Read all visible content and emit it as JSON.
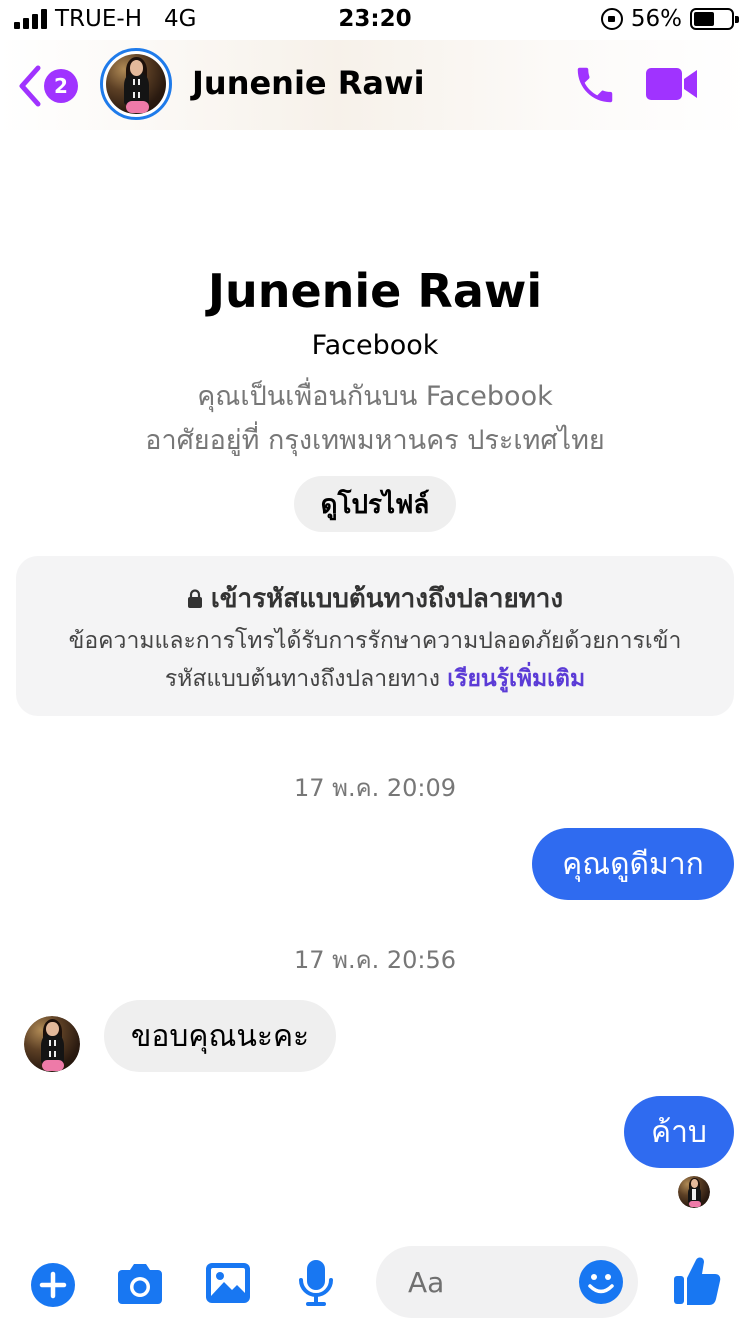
{
  "status_bar": {
    "carrier": "TRUE-H",
    "network": "4G",
    "time": "23:20",
    "battery": "56%",
    "battery_level": 0.56
  },
  "header": {
    "unread_count": "2",
    "contact_name": "Junenie Rawi",
    "icons": [
      "back-chevron-icon",
      "phone-icon",
      "video-camera-icon"
    ],
    "accent_color": "#a033ff"
  },
  "profile": {
    "name": "Junenie Rawi",
    "platform": "Facebook",
    "friends_text": "คุณเป็นเพื่อนกันบน Facebook",
    "location_text": "อาศัยอยู่ที่ กรุงเทพมหานคร ประเทศไทย",
    "view_profile_label": "ดูโปรไฟล์"
  },
  "encryption": {
    "title": "เข้ารหัสแบบต้นทางถึงปลายทาง",
    "body_line1": "ข้อความและการโทรได้รับการรักษาความปลอดภัยด้วยการเข้า",
    "body_line2": "รหัสแบบต้นทางถึงปลายทาง",
    "link": "เรียนรู้เพิ่มเติม",
    "icon": "lock-icon"
  },
  "conversation": {
    "timestamp_1": "17 พ.ค. 20:09",
    "msg_out_1": "คุณดูดีมาก",
    "timestamp_2": "17 พ.ค. 20:56",
    "msg_in_1": "ขอบคุณนะคะ",
    "msg_out_2": "ค้าบ",
    "bubble_color_outgoing": "#2f6bf0",
    "bubble_color_incoming": "#efefef"
  },
  "composer": {
    "placeholder": "Aa",
    "icons": [
      "plus-icon",
      "camera-icon",
      "image-icon",
      "microphone-icon",
      "emoji-icon",
      "thumbs-up-icon"
    ],
    "icon_color": "#1877f2"
  }
}
